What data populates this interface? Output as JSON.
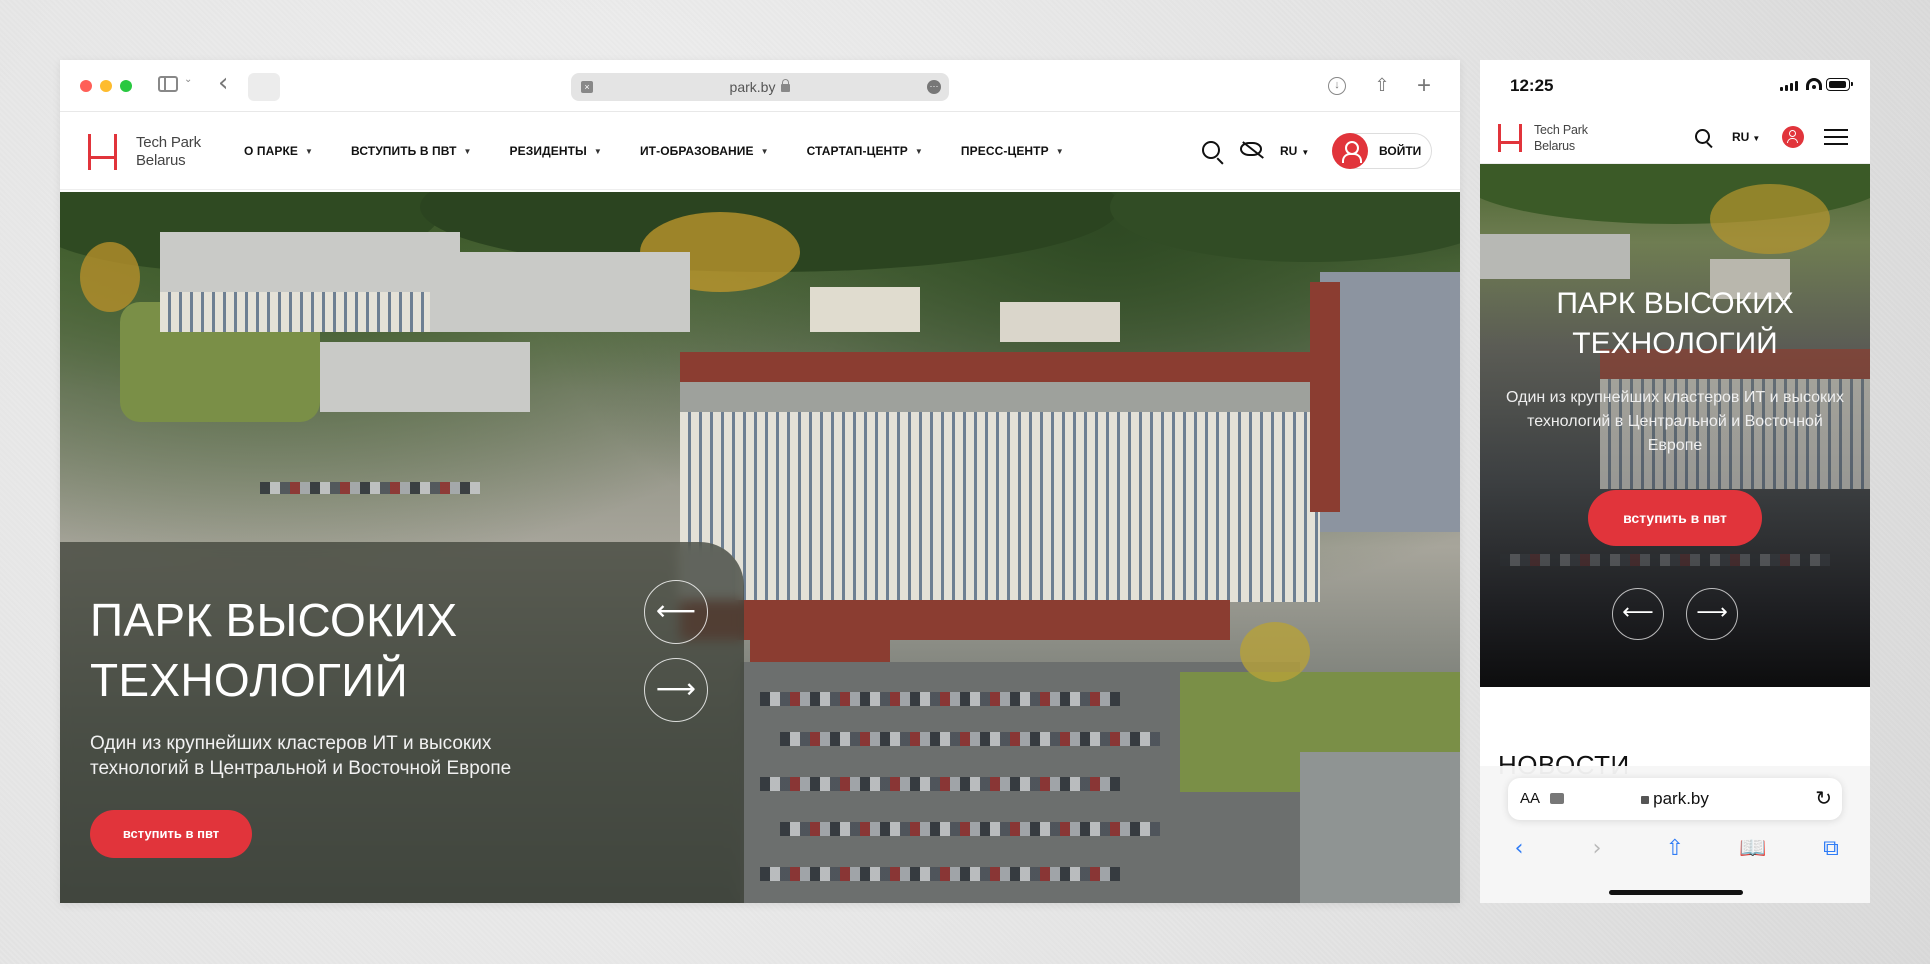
{
  "desktop": {
    "browser": {
      "url": "park.by"
    },
    "site": {
      "logo": {
        "line1": "Tech Park",
        "line2": "Belarus"
      },
      "menu": [
        {
          "label": "О ПАРКЕ"
        },
        {
          "label": "ВСТУПИТЬ В ПВТ"
        },
        {
          "label": "РЕЗИДЕНТЫ"
        },
        {
          "label": "ИТ-ОБРАЗОВАНИЕ"
        },
        {
          "label": "СТАРТАП-ЦЕНТР"
        },
        {
          "label": "ПРЕСС-ЦЕНТР"
        }
      ],
      "lang": "RU",
      "login_label": "ВОЙТИ"
    },
    "hero": {
      "title": "ПАРК ВЫСОКИХ ТЕХНОЛОГИЙ",
      "subtitle": "Один из крупнейших кластеров ИТ и высоких технологий в Центральной и Восточной Европе",
      "cta": "вступить в пвт",
      "prev_arrow": "⟵",
      "next_arrow": "⟶"
    }
  },
  "mobile": {
    "status": {
      "time": "12:25"
    },
    "site": {
      "logo": {
        "line1": "Tech Park",
        "line2": "Belarus"
      },
      "lang": "RU"
    },
    "hero": {
      "title": "ПАРК ВЫСОКИХ ТЕХНОЛОГИЙ",
      "subtitle": "Один из крупнейших кластеров ИТ и высоких технологий в Центральной и Восточной Европе",
      "cta": "вступить в пвт",
      "prev_arrow": "⟵",
      "next_arrow": "⟶"
    },
    "news_heading": "НОВОСТИ",
    "safari": {
      "aa": "AA",
      "url": "park.by",
      "reload": "↻",
      "toolbar": {
        "back": "‹",
        "forward": "›",
        "share": "⇧",
        "bookmarks": "📖",
        "tabs": "⧉"
      }
    }
  },
  "colors": {
    "brand_red": "#e1343b",
    "safari_blue": "#2f7cf6"
  }
}
